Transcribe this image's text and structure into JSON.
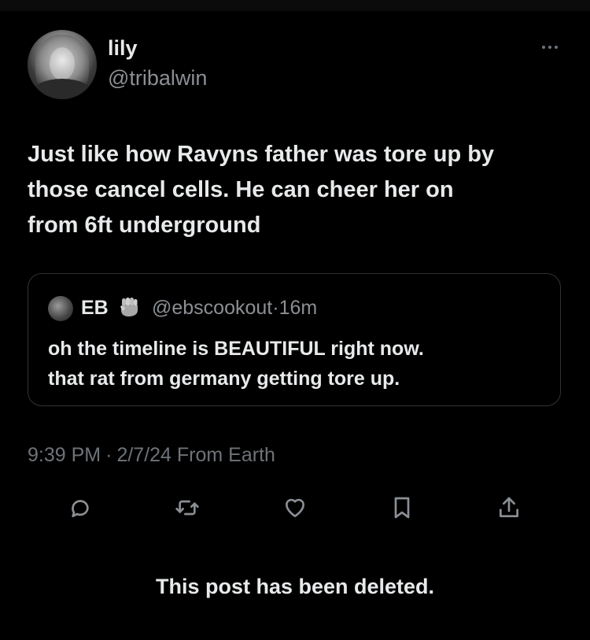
{
  "author": {
    "name": "lily",
    "handle": "@tribalwin"
  },
  "post": {
    "text": "Just like how Ravyns father was tore up by\nthose cancel cells. He can cheer her on\nfrom 6ft underground"
  },
  "quote": {
    "name": "EB",
    "handle": "@ebscookout",
    "separator": "·",
    "time": "16m",
    "text": "oh the timeline is BEAUTIFUL right now.\nthat rat from germany getting tore up."
  },
  "meta": {
    "time": "9:39 PM",
    "separator": "·",
    "date": "2/7/24",
    "source": "From Earth"
  },
  "actions": {
    "icons": [
      "reply-icon",
      "retweet-icon",
      "like-icon",
      "bookmark-icon",
      "share-icon"
    ]
  },
  "footer": {
    "deleted_notice": "This post has been deleted."
  },
  "colors": {
    "background": "#000000",
    "primary_text": "#e7e9ea",
    "secondary_text": "#8b8f94",
    "border": "#2f3336"
  }
}
